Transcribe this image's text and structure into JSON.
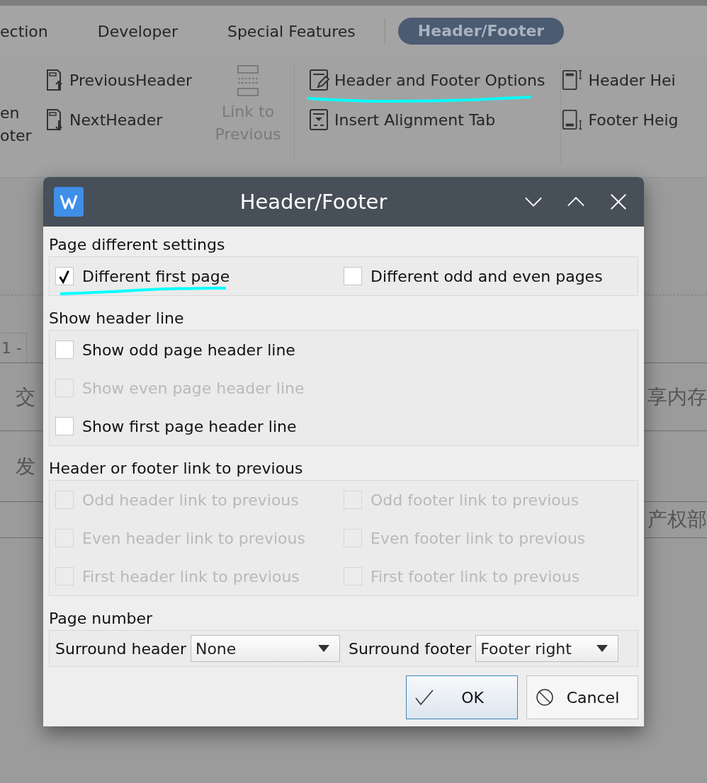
{
  "ribbon": {
    "tabs": [
      {
        "label": "ection",
        "selected": false
      },
      {
        "label": "Developer",
        "selected": false
      },
      {
        "label": "Special Features",
        "selected": false
      },
      {
        "label": "Header/Footer",
        "selected": true
      }
    ],
    "cut_label": [
      "en",
      "oter"
    ],
    "nav_buttons": [
      {
        "label": "PreviousHeader",
        "kind": "previous"
      },
      {
        "label": "NextHeader",
        "kind": "next"
      }
    ],
    "link_button": {
      "label": "Link to Previous",
      "disabled": true
    },
    "option_buttons": [
      {
        "label": "Header and Footer Options",
        "kind": "options"
      },
      {
        "label": "Insert Alignment Tab",
        "kind": "tab"
      }
    ],
    "size_buttons": [
      {
        "label": "Header Hei",
        "kind": "header"
      },
      {
        "label": "Footer Heig",
        "kind": "footer"
      }
    ]
  },
  "document": {
    "page_marker": "1 -",
    "left_text": [
      "交",
      "发"
    ],
    "right_text": [
      "享内存",
      "产权部"
    ]
  },
  "dialog": {
    "title": "Header/Footer",
    "sections": [
      {
        "title": "Page different settings",
        "rows": [
          [
            {
              "label": "Different first page",
              "checked": true,
              "disabled": false
            },
            {
              "label": "Different odd and even pages",
              "checked": false,
              "disabled": false
            }
          ]
        ]
      },
      {
        "title": "Show header line",
        "rows": [
          [
            {
              "label": "Show odd page header line",
              "checked": false,
              "disabled": false
            }
          ],
          [
            {
              "label": "Show even page header line",
              "checked": false,
              "disabled": true
            }
          ],
          [
            {
              "label": "Show first page header line",
              "checked": false,
              "disabled": false
            }
          ]
        ]
      },
      {
        "title": "Header or footer link to previous",
        "rows": [
          [
            {
              "label": "Odd header link to previous",
              "checked": false,
              "disabled": true
            },
            {
              "label": "Odd footer link to previous",
              "checked": false,
              "disabled": true
            }
          ],
          [
            {
              "label": "Even header link to previous",
              "checked": false,
              "disabled": true
            },
            {
              "label": "Even footer link to previous",
              "checked": false,
              "disabled": true
            }
          ],
          [
            {
              "label": "First header link to previous",
              "checked": false,
              "disabled": true
            },
            {
              "label": "First footer link to previous",
              "checked": false,
              "disabled": true
            }
          ]
        ]
      }
    ],
    "page_number": {
      "title": "Page number",
      "fields": [
        {
          "label": "Surround header",
          "value": "None"
        },
        {
          "label": "Surround footer",
          "value": "Footer right"
        }
      ]
    },
    "buttons": [
      {
        "label": "OK",
        "kind": "ok",
        "default": true
      },
      {
        "label": "Cancel",
        "kind": "cancel",
        "default": false
      }
    ]
  }
}
